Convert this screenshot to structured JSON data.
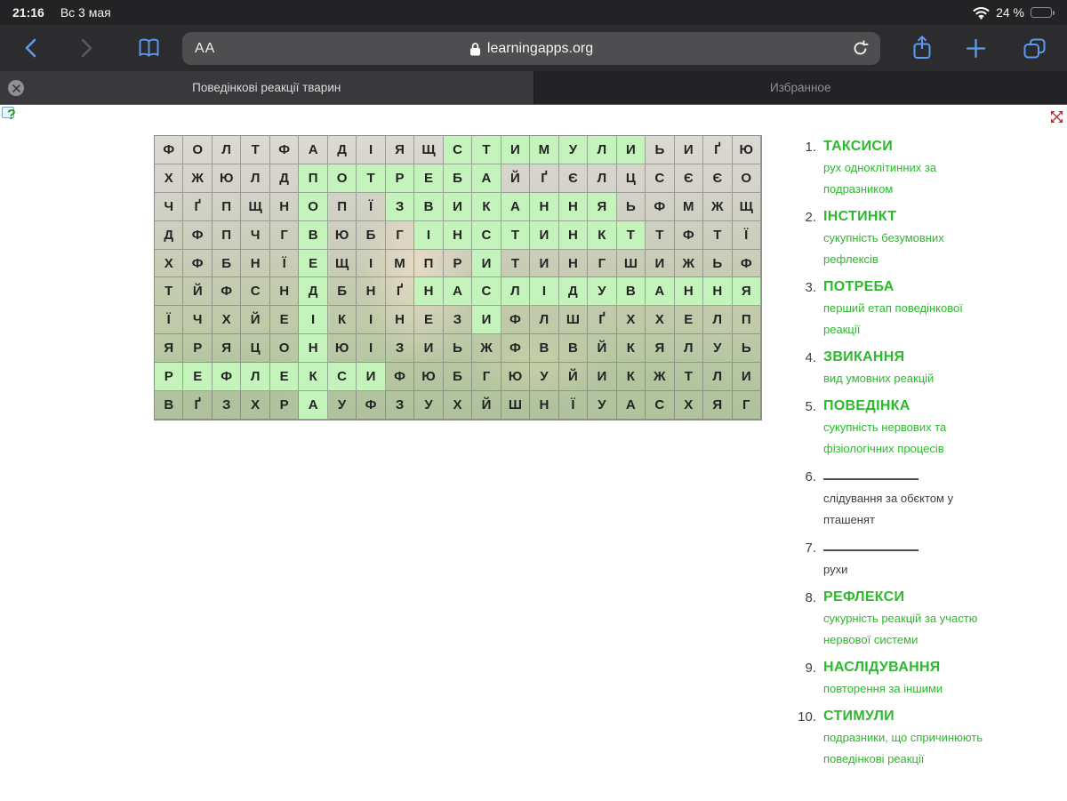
{
  "status_bar": {
    "time": "21:16",
    "date": "Вс 3 мая",
    "battery_percent": "24 %"
  },
  "toolbar": {
    "reader_label": "АА",
    "url": "learningapps.org",
    "icons": [
      "back-chevron",
      "forward-chevron",
      "bookmarks",
      "lock",
      "reload",
      "share",
      "new-tab-plus",
      "tab-overview"
    ]
  },
  "tabs": [
    {
      "label": "Поведінкові реакції тварин",
      "active": true
    },
    {
      "label": "Избранное",
      "active": false
    }
  ],
  "colors": {
    "accent_green": "#2db92d",
    "cell_highlight": "#c5f3bc",
    "ios_blue": "#5b9bf0",
    "fullscreen_red": "#b53131"
  },
  "puzzle": {
    "grid": {
      "rows": [
        [
          "Ф",
          "О",
          "Л",
          "Т",
          "Ф",
          "А",
          "Д",
          "І",
          "Я",
          "Щ",
          "С",
          "Т",
          "И",
          "М",
          "У",
          "Л",
          "И",
          "Ь",
          "И",
          "Ґ",
          "Ю"
        ],
        [
          "Х",
          "Ж",
          "Ю",
          "Л",
          "Д",
          "П",
          "О",
          "Т",
          "Р",
          "Е",
          "Б",
          "А",
          "Й",
          "Ґ",
          "Є",
          "Л",
          "Ц",
          "С",
          "Є",
          "Є",
          "О"
        ],
        [
          "Ч",
          "Ґ",
          "П",
          "Щ",
          "Н",
          "О",
          "П",
          "Ї",
          "З",
          "В",
          "И",
          "К",
          "А",
          "Н",
          "Н",
          "Я",
          "Ь",
          "Ф",
          "М",
          "Ж",
          "Щ"
        ],
        [
          "Д",
          "Ф",
          "П",
          "Ч",
          "Г",
          "В",
          "Ю",
          "Б",
          "Г",
          "І",
          "Н",
          "С",
          "Т",
          "И",
          "Н",
          "К",
          "Т",
          "Т",
          "Ф",
          "Т",
          "Ї"
        ],
        [
          "Х",
          "Ф",
          "Б",
          "Н",
          "Ї",
          "Е",
          "Щ",
          "І",
          "М",
          "П",
          "Р",
          "И",
          "Т",
          "И",
          "Н",
          "Г",
          "Ш",
          "И",
          "Ж",
          "Ь",
          "Ф"
        ],
        [
          "Т",
          "Й",
          "Ф",
          "С",
          "Н",
          "Д",
          "Б",
          "Н",
          "Ґ",
          "Н",
          "А",
          "С",
          "Л",
          "І",
          "Д",
          "У",
          "В",
          "А",
          "Н",
          "Н",
          "Я"
        ],
        [
          "Ї",
          "Ч",
          "Х",
          "Й",
          "Е",
          "І",
          "К",
          "І",
          "Н",
          "Е",
          "З",
          "И",
          "Ф",
          "Л",
          "Ш",
          "Ґ",
          "Х",
          "Х",
          "Е",
          "Л",
          "П"
        ],
        [
          "Я",
          "Р",
          "Я",
          "Ц",
          "О",
          "Н",
          "Ю",
          "І",
          "З",
          "И",
          "Ь",
          "Ж",
          "Ф",
          "В",
          "В",
          "Й",
          "К",
          "Я",
          "Л",
          "У",
          "Ь"
        ],
        [
          "Р",
          "Е",
          "Ф",
          "Л",
          "Е",
          "К",
          "С",
          "И",
          "Ф",
          "Ю",
          "Б",
          "Г",
          "Ю",
          "У",
          "Й",
          "И",
          "К",
          "Ж",
          "Т",
          "Л",
          "И"
        ],
        [
          "В",
          "Ґ",
          "З",
          "Х",
          "Р",
          "А",
          "У",
          "Ф",
          "З",
          "У",
          "Х",
          "Й",
          "Ш",
          "Н",
          "Ї",
          "У",
          "А",
          "С",
          "Х",
          "Я",
          "Г"
        ]
      ],
      "highlighted": [
        [
          1,
          11
        ],
        [
          1,
          12
        ],
        [
          1,
          13
        ],
        [
          1,
          14
        ],
        [
          1,
          15
        ],
        [
          1,
          16
        ],
        [
          1,
          17
        ],
        [
          2,
          6
        ],
        [
          2,
          7
        ],
        [
          2,
          8
        ],
        [
          2,
          9
        ],
        [
          2,
          10
        ],
        [
          2,
          11
        ],
        [
          2,
          12
        ],
        [
          3,
          6
        ],
        [
          3,
          9
        ],
        [
          3,
          10
        ],
        [
          3,
          11
        ],
        [
          3,
          12
        ],
        [
          3,
          13
        ],
        [
          3,
          14
        ],
        [
          3,
          15
        ],
        [
          3,
          16
        ],
        [
          4,
          6
        ],
        [
          4,
          10
        ],
        [
          4,
          11
        ],
        [
          4,
          12
        ],
        [
          4,
          13
        ],
        [
          4,
          14
        ],
        [
          4,
          15
        ],
        [
          4,
          16
        ],
        [
          4,
          17
        ],
        [
          5,
          6
        ],
        [
          5,
          12
        ],
        [
          6,
          6
        ],
        [
          6,
          10
        ],
        [
          6,
          11
        ],
        [
          6,
          12
        ],
        [
          6,
          13
        ],
        [
          6,
          14
        ],
        [
          6,
          15
        ],
        [
          6,
          16
        ],
        [
          6,
          17
        ],
        [
          6,
          18
        ],
        [
          6,
          19
        ],
        [
          6,
          20
        ],
        [
          6,
          21
        ],
        [
          7,
          6
        ],
        [
          7,
          12
        ],
        [
          8,
          6
        ],
        [
          9,
          1
        ],
        [
          9,
          2
        ],
        [
          9,
          3
        ],
        [
          9,
          4
        ],
        [
          9,
          5
        ],
        [
          9,
          6
        ],
        [
          9,
          7
        ],
        [
          9,
          8
        ],
        [
          10,
          6
        ]
      ]
    },
    "clues": [
      {
        "num": "1.",
        "word": "ТАКСИСИ",
        "found": true,
        "desc": [
          "рух одноклітинних за",
          "подразником"
        ]
      },
      {
        "num": "2.",
        "word": "ІНСТИНКТ",
        "found": true,
        "desc": [
          "сукупність безумовних",
          "рефлексів"
        ]
      },
      {
        "num": "3.",
        "word": "ПОТРЕБА",
        "found": true,
        "desc": [
          "перший етап поведінкової",
          "реакції"
        ]
      },
      {
        "num": "4.",
        "word": "ЗВИКАННЯ",
        "found": true,
        "desc": [
          "вид умовних реакцій"
        ]
      },
      {
        "num": "5.",
        "word": "ПОВЕДІНКА",
        "found": true,
        "desc": [
          "сукупність нервових та",
          "фізіологічних процесів"
        ]
      },
      {
        "num": "6.",
        "word": "",
        "found": false,
        "desc": [
          "слідування за обєктом у",
          "пташенят"
        ]
      },
      {
        "num": "7.",
        "word": "",
        "found": false,
        "desc": [
          "рухи"
        ]
      },
      {
        "num": "8.",
        "word": "РЕФЛЕКСИ",
        "found": true,
        "desc": [
          "сукурність реакцій за участю",
          "нервової системи"
        ]
      },
      {
        "num": "9.",
        "word": "НАСЛІДУВАННЯ",
        "found": true,
        "desc": [
          "повторення за іншими"
        ]
      },
      {
        "num": "10.",
        "word": "СТИМУЛИ",
        "found": true,
        "desc": [
          "подразники, що спричинюють",
          "поведінкові реакції"
        ]
      }
    ]
  }
}
